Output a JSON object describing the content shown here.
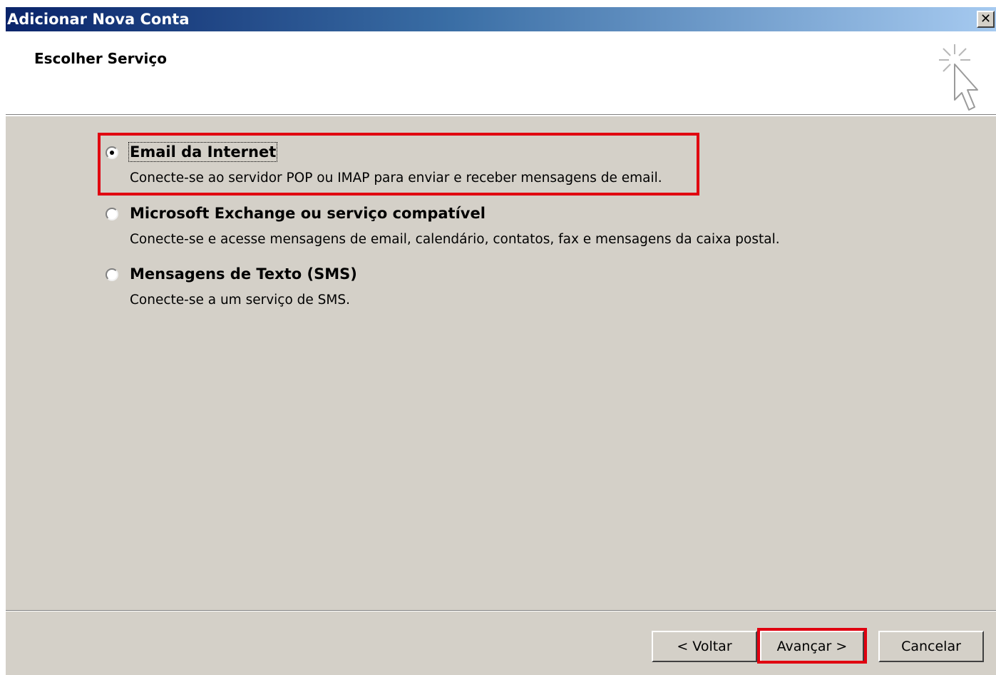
{
  "window": {
    "title": "Adicionar Nova Conta",
    "close_glyph": "✕"
  },
  "header": {
    "title": "Escolher Serviço",
    "icon": "wizard-cursor-icon"
  },
  "options": [
    {
      "title": "Email da Internet",
      "description": "Conecte-se ao servidor POP ou IMAP para enviar e receber mensagens de email.",
      "selected": true
    },
    {
      "title": "Microsoft Exchange ou serviço compatível",
      "description": "Conecte-se e acesse mensagens de email, calendário, contatos, fax e mensagens da caixa postal.",
      "selected": false
    },
    {
      "title": "Mensagens de Texto (SMS)",
      "description": "Conecte-se a um serviço de SMS.",
      "selected": false
    }
  ],
  "buttons": {
    "back": "< Voltar",
    "next": "Avançar >",
    "cancel": "Cancelar"
  },
  "colors": {
    "highlight": "#e00010",
    "dialog_bg": "#d4d0c8",
    "titlebar_start": "#0a246a",
    "titlebar_end": "#a6caf0"
  }
}
